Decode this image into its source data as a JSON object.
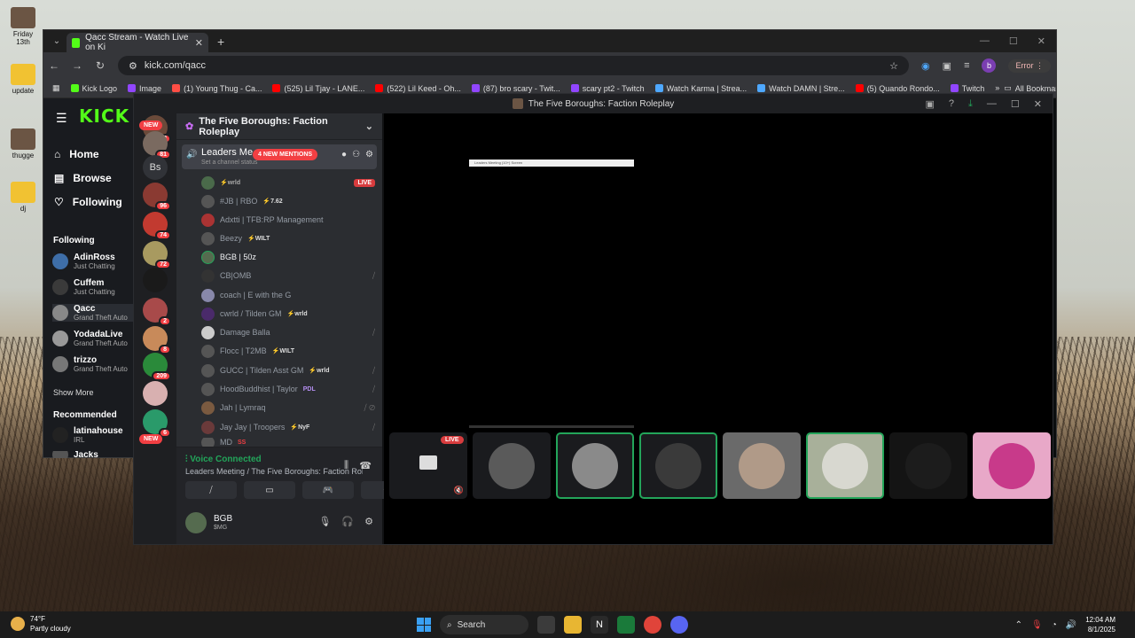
{
  "desktop": {
    "icons": [
      {
        "label": "Friday 13th"
      },
      {
        "label": "update"
      },
      {
        "label": "thugge"
      },
      {
        "label": "dj"
      }
    ]
  },
  "browser": {
    "tab_title": "Qacc Stream - Watch Live on Ki",
    "url": "kick.com/qacc",
    "profile_initial": "b",
    "error_label": "Error",
    "bookmarks": [
      "Kick Logo",
      "Image",
      "(1) Young Thug - Ca...",
      "(525) Lil Tjay - LANE...",
      "(522) Lil Keed - Oh...",
      "(87) bro scary - Twit...",
      "scary pt2 - Twitch",
      "Watch Karma | Strea...",
      "Watch DAMN | Stre...",
      "(5) Quando Rondo...",
      "Twitch"
    ],
    "all_bookmarks": "All Bookmarks"
  },
  "kick": {
    "logo": "KICK",
    "nav": [
      {
        "label": "Home",
        "icon": "home-icon"
      },
      {
        "label": "Browse",
        "icon": "browse-icon"
      },
      {
        "label": "Following",
        "icon": "heart-icon"
      }
    ],
    "following_title": "Following",
    "following": [
      {
        "name": "AdinRoss",
        "category": "Just Chatting"
      },
      {
        "name": "Cuffem",
        "category": "Just Chatting"
      },
      {
        "name": "Qacc",
        "category": "Grand Theft Auto"
      },
      {
        "name": "YodadaLive",
        "category": "Grand Theft Auto"
      },
      {
        "name": "trizzo",
        "category": "Grand Theft Auto"
      }
    ],
    "show_more": "Show More",
    "recommended_title": "Recommended",
    "recommended": [
      {
        "name": "latinahouse",
        "category": "IRL"
      },
      {
        "name": "Jacks",
        "category": ""
      }
    ]
  },
  "discord": {
    "window_title": "The Five Boroughs: Faction Roleplay",
    "servers": {
      "new_top": "NEW",
      "new_bottom": "NEW",
      "text_server": "Bs",
      "badges": [
        "12",
        "81",
        "96",
        "74",
        "72",
        "2",
        "8",
        "209",
        "6"
      ]
    },
    "guild_name": "The Five Boroughs: Faction Roleplay",
    "voice_channel": {
      "name": "Leaders Me",
      "status_placeholder": "Set a channel status",
      "mentions": "4 NEW MENTIONS"
    },
    "members": [
      {
        "name": "",
        "tag": "wrld",
        "live": "LIVE"
      },
      {
        "name": "#JB | RBO",
        "tag": "7.62"
      },
      {
        "name": "Adxtti | TFB:RP Management",
        "tag": ""
      },
      {
        "name": "Beezy",
        "tag": "WILT"
      },
      {
        "name": "BGB | 50z",
        "tag": ""
      },
      {
        "name": "CB|OMB",
        "tag": ""
      },
      {
        "name": "coach | E with the G",
        "tag": ""
      },
      {
        "name": "cwrld / Tilden GM",
        "tag": "wrld"
      },
      {
        "name": "Damage Balla",
        "tag": ""
      },
      {
        "name": "Flocc | T2MB",
        "tag": "WILT"
      },
      {
        "name": "GUCC | Tilden Asst GM",
        "tag": "wrld"
      },
      {
        "name": "HoodBuddhist | Taylor",
        "tag": "PDL"
      },
      {
        "name": "Jah | Lymraq",
        "tag": ""
      },
      {
        "name": "Jay Jay | Troopers",
        "tag": "NyF"
      },
      {
        "name": "MD",
        "tag": "SS"
      }
    ],
    "voice_connected": "Voice Connected",
    "voice_path": "Leaders Meeting / The Five Boroughs: Faction Rol...",
    "user": {
      "name": "BGB",
      "status": "$MG"
    },
    "stage": {
      "live_label": "LIVE",
      "preview_text": "Leaders Meeting (10+) Screen"
    }
  },
  "taskbar": {
    "temp": "74°F",
    "weather": "Partly cloudy",
    "search": "Search",
    "time": "12:04 AM",
    "date": "8/1/2025"
  }
}
